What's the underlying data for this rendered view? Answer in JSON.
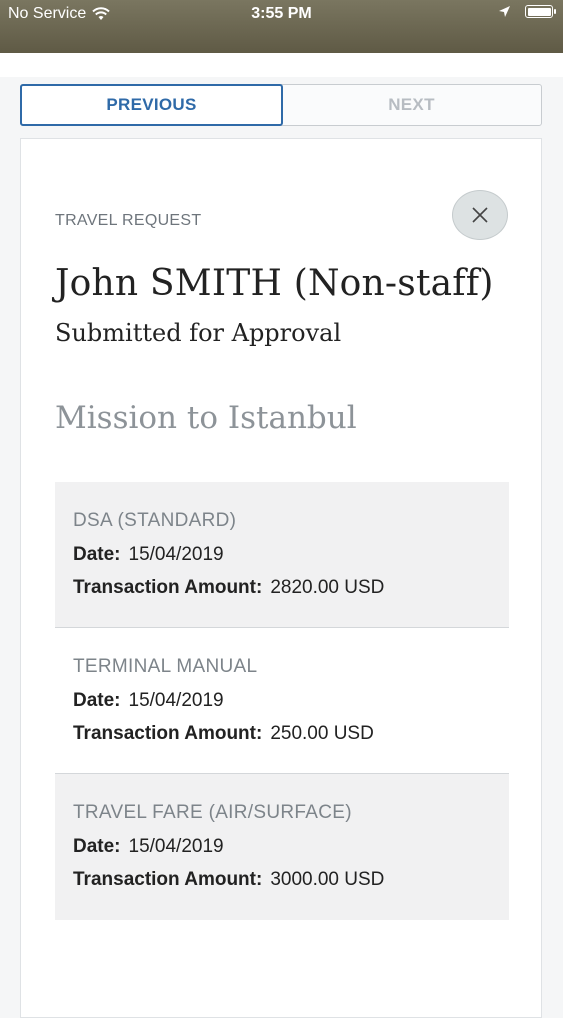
{
  "status_bar": {
    "carrier": "No Service",
    "time": "3:55 PM",
    "icons": [
      "wifi-icon",
      "location-arrow-icon",
      "battery-icon"
    ]
  },
  "nav": {
    "previous": "PREVIOUS",
    "next": "NEXT"
  },
  "request": {
    "eyebrow": "TRAVEL REQUEST",
    "name": "John SMITH (Non-staff)",
    "status": "Submitted for Approval",
    "mission": "Mission to Istanbul",
    "close_icon": "close-icon"
  },
  "items": [
    {
      "title": "DSA (STANDARD)",
      "date_label": "Date:",
      "date": "15/04/2019",
      "amount_label": "Transaction Amount:",
      "amount": "2820.00 USD"
    },
    {
      "title": "TERMINAL MANUAL",
      "date_label": "Date:",
      "date": "15/04/2019",
      "amount_label": "Transaction Amount:",
      "amount": "250.00 USD"
    },
    {
      "title": "TRAVEL FARE (AIR/SURFACE)",
      "date_label": "Date:",
      "date": "15/04/2019",
      "amount_label": "Transaction Amount:",
      "amount": "3000.00 USD"
    }
  ],
  "colors": {
    "accent": "#2f6aa8",
    "muted_text": "#7d848a",
    "shaded_row": "#f1f1f2"
  }
}
